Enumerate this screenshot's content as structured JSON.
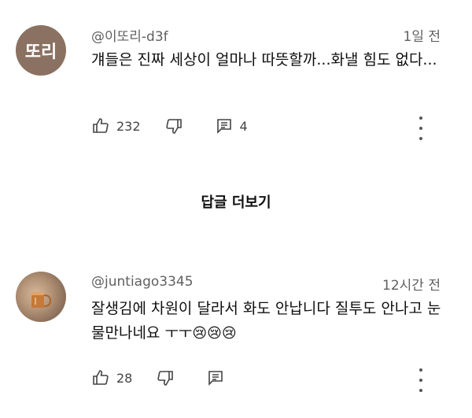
{
  "comments": [
    {
      "avatar_text": "또리",
      "handle": "@이또리-d3f",
      "time": "1일 전",
      "text": "걔들은 진짜 세상이 얼마나 따뜻할까...화낼 힘도 없다...",
      "likes": "232",
      "replies_count": "4"
    },
    {
      "handle": "@juntiago3345",
      "time": "12시간 전",
      "text": "잘생김에 차원이 달라서 화도 안납니다 질투도 안나고 눈물만나네요 ㅜㅜ",
      "emojis": "😢😢😢",
      "likes": "28"
    }
  ],
  "more_replies_label": "답글 더보기",
  "icons": {
    "like": "thumbs-up-icon",
    "dislike": "thumbs-down-icon",
    "reply": "comment-icon",
    "more": "more-vertical-icon"
  },
  "colors": {
    "avatar_bg": "#8a7161",
    "secondary_text": "#606060"
  }
}
